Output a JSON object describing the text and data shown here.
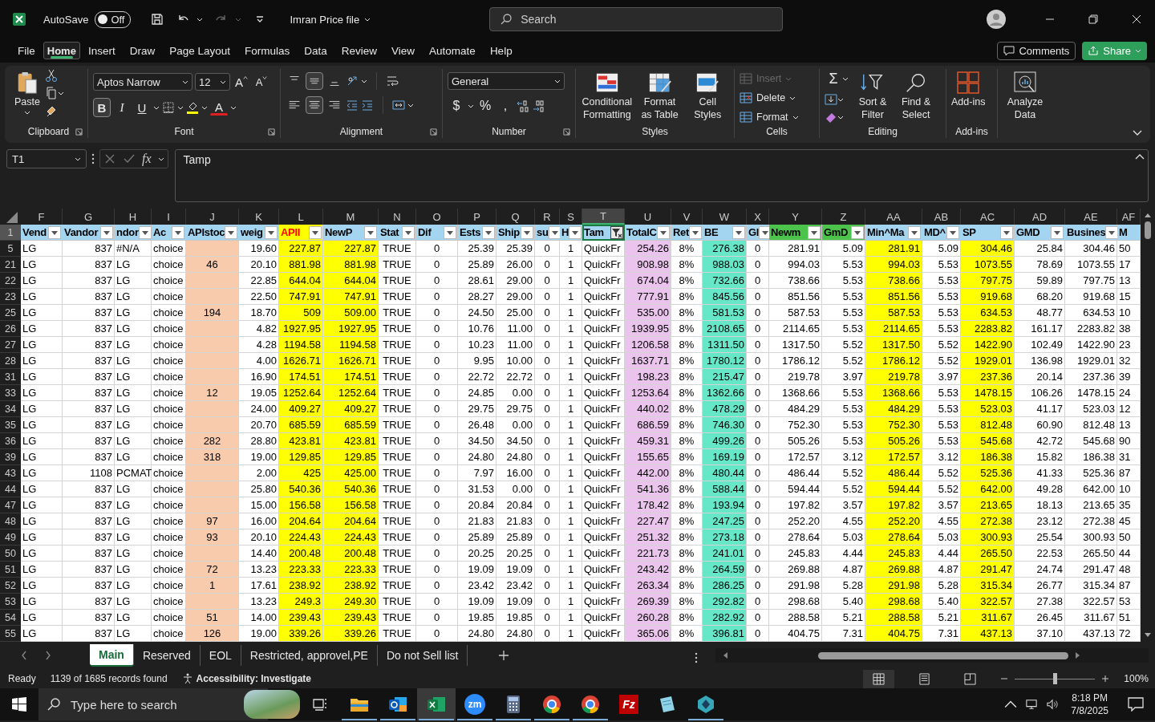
{
  "title_bar": {
    "autosave_label": "AutoSave",
    "autosave": {
      "on": false,
      "label": "Off"
    },
    "file_name": "Imran Price file",
    "search_placeholder": "Search"
  },
  "menu": {
    "tabs": [
      {
        "label": "File",
        "selected": false
      },
      {
        "label": "Home",
        "selected": true
      },
      {
        "label": "Insert",
        "selected": false
      },
      {
        "label": "Draw",
        "selected": false
      },
      {
        "label": "Page Layout",
        "selected": false
      },
      {
        "label": "Formulas",
        "selected": false
      },
      {
        "label": "Data",
        "selected": false
      },
      {
        "label": "Review",
        "selected": false
      },
      {
        "label": "View",
        "selected": false
      },
      {
        "label": "Automate",
        "selected": false
      },
      {
        "label": "Help",
        "selected": false
      }
    ],
    "comments": "Comments",
    "share": "Share"
  },
  "ribbon": {
    "clipboard": {
      "group": "Clipboard",
      "paste": "Paste"
    },
    "font": {
      "group": "Font",
      "family": "Aptos Narrow",
      "size": "12",
      "grow": "A",
      "shrink": "A",
      "font_color": "A",
      "format_buttons": [
        {
          "label": "B",
          "pressed": true
        },
        {
          "label": "I",
          "pressed": false
        },
        {
          "label": "U",
          "pressed": false
        }
      ]
    },
    "alignment": {
      "group": "Alignment",
      "vertical": [
        {
          "kind": "top",
          "pressed": false
        },
        {
          "kind": "middle",
          "pressed": true
        },
        {
          "kind": "bottom",
          "pressed": false
        }
      ],
      "horizontal": [
        {
          "kind": "left",
          "pressed": false
        },
        {
          "kind": "center",
          "pressed": true
        },
        {
          "kind": "right",
          "pressed": false
        }
      ]
    },
    "number": {
      "group": "Number",
      "format": "General",
      "symbols": [
        "$",
        "%",
        ","
      ]
    },
    "styles": {
      "group": "Styles",
      "buttons": [
        "Conditional Formatting",
        "Format as Table",
        "Cell Styles"
      ]
    },
    "cells": {
      "group": "Cells",
      "buttons": [
        {
          "label": "Insert",
          "disabled": true
        },
        {
          "label": "Delete",
          "disabled": false
        },
        {
          "label": "Format",
          "disabled": false
        }
      ]
    },
    "editing": {
      "group": "Editing",
      "sum": "Σ",
      "buttons": [
        "Sort & Filter",
        "Find & Select"
      ]
    },
    "addins": {
      "group": "Add-ins",
      "button": "Add-ins"
    },
    "analyze": {
      "button": "Analyze Data"
    }
  },
  "formula_bar": {
    "name_box": "T1",
    "function_label": "fx",
    "value": "Tamp"
  },
  "sheet": {
    "columns": [
      {
        "letter": "F",
        "header": {
          "label": "Vend",
          "color": "#a3d4f0",
          "kind": "plain"
        },
        "color": "#ffffff",
        "selected": false,
        "filter_applied": false
      },
      {
        "letter": "G",
        "header": {
          "label": "Vandor",
          "color": "#a3d4f0",
          "kind": "plain"
        },
        "color": "#ffffff",
        "selected": false,
        "filter_applied": false
      },
      {
        "letter": "H",
        "header": {
          "label": "ndor",
          "color": "#a3d4f0",
          "kind": "plain"
        },
        "color": "#ffffff",
        "selected": false,
        "filter_applied": false
      },
      {
        "letter": "I",
        "header": {
          "label": "Ac",
          "color": "#a3d4f0",
          "kind": "plain"
        },
        "color": "#ffffff",
        "selected": false,
        "filter_applied": false
      },
      {
        "letter": "J",
        "header": {
          "label": "APIstoc",
          "color": "#a3d4f0",
          "kind": "plain"
        },
        "color": "#f8cbad",
        "selected": false,
        "filter_applied": false
      },
      {
        "letter": "K",
        "header": {
          "label": "weig",
          "color": "#a3d4f0",
          "kind": "plain"
        },
        "color": "#ffffff",
        "selected": false,
        "filter_applied": false
      },
      {
        "letter": "L",
        "header": {
          "label": "APII",
          "color": "#ffff00",
          "kind": "alert"
        },
        "color": "#ffff00",
        "selected": false,
        "filter_applied": false
      },
      {
        "letter": "M",
        "header": {
          "label": "NewP",
          "color": "#a3d4f0",
          "kind": "plain"
        },
        "color": "#ffff00",
        "selected": false,
        "filter_applied": false
      },
      {
        "letter": "N",
        "header": {
          "label": "Stat",
          "color": "#a3d4f0",
          "kind": "plain"
        },
        "color": "#ffffff",
        "selected": false,
        "filter_applied": false
      },
      {
        "letter": "O",
        "header": {
          "label": "Dif",
          "color": "#a3d4f0",
          "kind": "plain"
        },
        "color": "#ffffff",
        "selected": false,
        "filter_applied": false
      },
      {
        "letter": "P",
        "header": {
          "label": "Ests",
          "color": "#a3d4f0",
          "kind": "plain"
        },
        "color": "#ffffff",
        "selected": false,
        "filter_applied": false
      },
      {
        "letter": "Q",
        "header": {
          "label": "Ship",
          "color": "#a3d4f0",
          "kind": "plain"
        },
        "color": "#ffffff",
        "selected": false,
        "filter_applied": false
      },
      {
        "letter": "R",
        "header": {
          "label": "su",
          "color": "#a3d4f0",
          "kind": "plain"
        },
        "color": "#ffffff",
        "selected": false,
        "filter_applied": false
      },
      {
        "letter": "S",
        "header": {
          "label": "H",
          "color": "#a3d4f0",
          "kind": "plain"
        },
        "color": "#ffffff",
        "selected": false,
        "filter_applied": false
      },
      {
        "letter": "T",
        "header": {
          "label": "Tam",
          "color": "#a3d4f0",
          "kind": "plain"
        },
        "color": "#ffffff",
        "selected": true,
        "filter_applied": true
      },
      {
        "letter": "U",
        "header": {
          "label": "TotalC",
          "color": "#a3d4f0",
          "kind": "plain"
        },
        "color": "#eac4ec",
        "selected": false,
        "filter_applied": false
      },
      {
        "letter": "V",
        "header": {
          "label": "Ret",
          "color": "#a3d4f0",
          "kind": "plain"
        },
        "color": "#ffffff",
        "selected": false,
        "filter_applied": false
      },
      {
        "letter": "W",
        "header": {
          "label": "BE",
          "color": "#a3d4f0",
          "kind": "plain"
        },
        "color": "#66e8c8",
        "selected": false,
        "filter_applied": false
      },
      {
        "letter": "X",
        "header": {
          "label": "Gl",
          "color": "#a3d4f0",
          "kind": "plain"
        },
        "color": "#ffffff",
        "selected": false,
        "filter_applied": false
      },
      {
        "letter": "Y",
        "header": {
          "label": "Newm",
          "color": "#4cc44c",
          "kind": "plain"
        },
        "color": "#ffffff",
        "selected": false,
        "filter_applied": false
      },
      {
        "letter": "Z",
        "header": {
          "label": "GmD",
          "color": "#4cc44c",
          "kind": "plain"
        },
        "color": "#ffffff",
        "selected": false,
        "filter_applied": false
      },
      {
        "letter": "AA",
        "header": {
          "label": "Min^Ma",
          "color": "#a3d4f0",
          "kind": "plain"
        },
        "color": "#ffff00",
        "selected": false,
        "filter_applied": false
      },
      {
        "letter": "AB",
        "header": {
          "label": "MD^",
          "color": "#a3d4f0",
          "kind": "plain"
        },
        "color": "#ffffff",
        "selected": false,
        "filter_applied": false
      },
      {
        "letter": "AC",
        "header": {
          "label": "SP",
          "color": "#a3d4f0",
          "kind": "plain"
        },
        "color": "#ffff00",
        "selected": false,
        "filter_applied": false
      },
      {
        "letter": "AD",
        "header": {
          "label": "GMD",
          "color": "#a3d4f0",
          "kind": "plain"
        },
        "color": "#ffffff",
        "selected": false,
        "filter_applied": false
      },
      {
        "letter": "AE",
        "header": {
          "label": "Busines",
          "color": "#a3d4f0",
          "kind": "plain"
        },
        "color": "#ffffff",
        "selected": false,
        "filter_applied": false
      },
      {
        "letter": "AF",
        "header": {
          "label": "M",
          "color": "#a3d4f0",
          "kind": "plain"
        },
        "color": "#ffffff",
        "selected": false
      }
    ],
    "header_row": "1",
    "rows": [
      {
        "number": "5",
        "cells": [
          "LG",
          "837",
          "#N/A",
          "choice",
          null,
          "19.60",
          "227.87",
          "227.87",
          "TRUE",
          "0",
          "25.39",
          "25.39",
          "0",
          "1",
          "QuickFr",
          "254.26",
          "8%",
          "276.38",
          "0",
          "281.91",
          "5.09",
          "281.91",
          "5.09",
          "304.46",
          "25.84",
          "304.46",
          "50"
        ]
      },
      {
        "number": "21",
        "cells": [
          "LG",
          "837",
          "LG",
          "choice",
          "46",
          "20.10",
          "881.98",
          "881.98",
          "TRUE",
          "0",
          "25.89",
          "26.00",
          "0",
          "1",
          "QuickFr",
          "908.98",
          "8%",
          "988.03",
          "0",
          "994.03",
          "5.53",
          "994.03",
          "5.53",
          "1073.55",
          "78.69",
          "1073.55",
          "17"
        ]
      },
      {
        "number": "22",
        "cells": [
          "LG",
          "837",
          "LG",
          "choice",
          null,
          "22.85",
          "644.04",
          "644.04",
          "TRUE",
          "0",
          "28.61",
          "29.00",
          "0",
          "1",
          "QuickFr",
          "674.04",
          "8%",
          "732.66",
          "0",
          "738.66",
          "5.53",
          "738.66",
          "5.53",
          "797.75",
          "59.89",
          "797.75",
          "13"
        ]
      },
      {
        "number": "23",
        "cells": [
          "LG",
          "837",
          "LG",
          "choice",
          null,
          "22.50",
          "747.91",
          "747.91",
          "TRUE",
          "0",
          "28.27",
          "29.00",
          "0",
          "1",
          "QuickFr",
          "777.91",
          "8%",
          "845.56",
          "0",
          "851.56",
          "5.53",
          "851.56",
          "5.53",
          "919.68",
          "68.20",
          "919.68",
          "15"
        ]
      },
      {
        "number": "25",
        "cells": [
          "LG",
          "837",
          "LG",
          "choice",
          "194",
          "18.70",
          "509",
          "509.00",
          "TRUE",
          "0",
          "24.50",
          "25.00",
          "0",
          "1",
          "QuickFr",
          "535.00",
          "8%",
          "581.53",
          "0",
          "587.53",
          "5.53",
          "587.53",
          "5.53",
          "634.53",
          "48.77",
          "634.53",
          "10"
        ]
      },
      {
        "number": "26",
        "cells": [
          "LG",
          "837",
          "LG",
          "choice",
          null,
          "4.82",
          "1927.95",
          "1927.95",
          "TRUE",
          "0",
          "10.76",
          "11.00",
          "0",
          "1",
          "QuickFr",
          "1939.95",
          "8%",
          "2108.65",
          "0",
          "2114.65",
          "5.53",
          "2114.65",
          "5.53",
          "2283.82",
          "161.17",
          "2283.82",
          "38"
        ]
      },
      {
        "number": "27",
        "cells": [
          "LG",
          "837",
          "LG",
          "choice",
          null,
          "4.28",
          "1194.58",
          "1194.58",
          "TRUE",
          "0",
          "10.23",
          "11.00",
          "0",
          "1",
          "QuickFr",
          "1206.58",
          "8%",
          "1311.50",
          "0",
          "1317.50",
          "5.52",
          "1317.50",
          "5.52",
          "1422.90",
          "102.49",
          "1422.90",
          "23"
        ]
      },
      {
        "number": "28",
        "cells": [
          "LG",
          "837",
          "LG",
          "choice",
          null,
          "4.00",
          "1626.71",
          "1626.71",
          "TRUE",
          "0",
          "9.95",
          "10.00",
          "0",
          "1",
          "QuickFr",
          "1637.71",
          "8%",
          "1780.12",
          "0",
          "1786.12",
          "5.52",
          "1786.12",
          "5.52",
          "1929.01",
          "136.98",
          "1929.01",
          "32"
        ]
      },
      {
        "number": "31",
        "cells": [
          "LG",
          "837",
          "LG",
          "choice",
          null,
          "16.90",
          "174.51",
          "174.51",
          "TRUE",
          "0",
          "22.72",
          "22.72",
          "0",
          "1",
          "QuickFr",
          "198.23",
          "8%",
          "215.47",
          "0",
          "219.78",
          "3.97",
          "219.78",
          "3.97",
          "237.36",
          "20.14",
          "237.36",
          "39"
        ]
      },
      {
        "number": "33",
        "cells": [
          "LG",
          "837",
          "LG",
          "choice",
          "12",
          "19.05",
          "1252.64",
          "1252.64",
          "TRUE",
          "0",
          "24.85",
          "0.00",
          "0",
          "1",
          "QuickFr",
          "1253.64",
          "8%",
          "1362.66",
          "0",
          "1368.66",
          "5.53",
          "1368.66",
          "5.53",
          "1478.15",
          "106.26",
          "1478.15",
          "24"
        ]
      },
      {
        "number": "34",
        "cells": [
          "LG",
          "837",
          "LG",
          "choice",
          null,
          "24.00",
          "409.27",
          "409.27",
          "TRUE",
          "0",
          "29.75",
          "29.75",
          "0",
          "1",
          "QuickFr",
          "440.02",
          "8%",
          "478.29",
          "0",
          "484.29",
          "5.53",
          "484.29",
          "5.53",
          "523.03",
          "41.17",
          "523.03",
          "12"
        ]
      },
      {
        "number": "35",
        "cells": [
          "LG",
          "837",
          "LG",
          "choice",
          null,
          "20.70",
          "685.59",
          "685.59",
          "TRUE",
          "0",
          "26.48",
          "0.00",
          "0",
          "1",
          "QuickFr",
          "686.59",
          "8%",
          "746.30",
          "0",
          "752.30",
          "5.53",
          "752.30",
          "5.53",
          "812.48",
          "60.90",
          "812.48",
          "13"
        ]
      },
      {
        "number": "36",
        "cells": [
          "LG",
          "837",
          "LG",
          "choice",
          "282",
          "28.80",
          "423.81",
          "423.81",
          "TRUE",
          "0",
          "34.50",
          "34.50",
          "0",
          "1",
          "QuickFr",
          "459.31",
          "8%",
          "499.26",
          "0",
          "505.26",
          "5.53",
          "505.26",
          "5.53",
          "545.68",
          "42.72",
          "545.68",
          "90"
        ]
      },
      {
        "number": "39",
        "cells": [
          "LG",
          "837",
          "LG",
          "choice",
          "318",
          "19.00",
          "129.85",
          "129.85",
          "TRUE",
          "0",
          "24.80",
          "24.80",
          "0",
          "1",
          "QuickFr",
          "155.65",
          "8%",
          "169.19",
          "0",
          "172.57",
          "3.12",
          "172.57",
          "3.12",
          "186.38",
          "15.82",
          "186.38",
          "31"
        ]
      },
      {
        "number": "43",
        "cells": [
          "LG",
          "1108",
          "PCMAT",
          "choice",
          null,
          "2.00",
          "425",
          "425.00",
          "TRUE",
          "0",
          "7.97",
          "16.00",
          "0",
          "1",
          "QuickFr",
          "442.00",
          "8%",
          "480.44",
          "0",
          "486.44",
          "5.52",
          "486.44",
          "5.52",
          "525.36",
          "41.33",
          "525.36",
          "87"
        ]
      },
      {
        "number": "44",
        "cells": [
          "LG",
          "837",
          "LG",
          "choice",
          null,
          "25.80",
          "540.36",
          "540.36",
          "TRUE",
          "0",
          "31.53",
          "0.00",
          "0",
          "1",
          "QuickFr",
          "541.36",
          "8%",
          "588.44",
          "0",
          "594.44",
          "5.52",
          "594.44",
          "5.52",
          "642.00",
          "49.28",
          "642.00",
          "10"
        ]
      },
      {
        "number": "47",
        "cells": [
          "LG",
          "837",
          "LG",
          "choice",
          null,
          "15.00",
          "156.58",
          "156.58",
          "TRUE",
          "0",
          "20.84",
          "20.84",
          "0",
          "1",
          "QuickFr",
          "178.42",
          "8%",
          "193.94",
          "0",
          "197.82",
          "3.57",
          "197.82",
          "3.57",
          "213.65",
          "18.13",
          "213.65",
          "35"
        ]
      },
      {
        "number": "48",
        "cells": [
          "LG",
          "837",
          "LG",
          "choice",
          "97",
          "16.00",
          "204.64",
          "204.64",
          "TRUE",
          "0",
          "21.83",
          "21.83",
          "0",
          "1",
          "QuickFr",
          "227.47",
          "8%",
          "247.25",
          "0",
          "252.20",
          "4.55",
          "252.20",
          "4.55",
          "272.38",
          "23.12",
          "272.38",
          "45"
        ]
      },
      {
        "number": "49",
        "cells": [
          "LG",
          "837",
          "LG",
          "choice",
          "93",
          "20.10",
          "224.43",
          "224.43",
          "TRUE",
          "0",
          "25.89",
          "25.89",
          "0",
          "1",
          "QuickFr",
          "251.32",
          "8%",
          "273.18",
          "0",
          "278.64",
          "5.03",
          "278.64",
          "5.03",
          "300.93",
          "25.54",
          "300.93",
          "50"
        ]
      },
      {
        "number": "50",
        "cells": [
          "LG",
          "837",
          "LG",
          "choice",
          null,
          "14.40",
          "200.48",
          "200.48",
          "TRUE",
          "0",
          "20.25",
          "20.25",
          "0",
          "1",
          "QuickFr",
          "221.73",
          "8%",
          "241.01",
          "0",
          "245.83",
          "4.44",
          "245.83",
          "4.44",
          "265.50",
          "22.53",
          "265.50",
          "44"
        ]
      },
      {
        "number": "51",
        "cells": [
          "LG",
          "837",
          "LG",
          "choice",
          "72",
          "13.23",
          "223.33",
          "223.33",
          "TRUE",
          "0",
          "19.09",
          "19.09",
          "0",
          "1",
          "QuickFr",
          "243.42",
          "8%",
          "264.59",
          "0",
          "269.88",
          "4.87",
          "269.88",
          "4.87",
          "291.47",
          "24.74",
          "291.47",
          "48"
        ]
      },
      {
        "number": "52",
        "cells": [
          "LG",
          "837",
          "LG",
          "choice",
          "1",
          "17.61",
          "238.92",
          "238.92",
          "TRUE",
          "0",
          "23.42",
          "23.42",
          "0",
          "1",
          "QuickFr",
          "263.34",
          "8%",
          "286.25",
          "0",
          "291.98",
          "5.28",
          "291.98",
          "5.28",
          "315.34",
          "26.77",
          "315.34",
          "87"
        ]
      },
      {
        "number": "53",
        "cells": [
          "LG",
          "837",
          "LG",
          "choice",
          null,
          "13.23",
          "249.3",
          "249.30",
          "TRUE",
          "0",
          "19.09",
          "19.09",
          "0",
          "1",
          "QuickFr",
          "269.39",
          "8%",
          "292.82",
          "0",
          "298.68",
          "5.40",
          "298.68",
          "5.40",
          "322.57",
          "27.38",
          "322.57",
          "53"
        ]
      },
      {
        "number": "54",
        "cells": [
          "LG",
          "837",
          "LG",
          "choice",
          "51",
          "14.00",
          "239.43",
          "239.43",
          "TRUE",
          "0",
          "19.85",
          "19.85",
          "0",
          "1",
          "QuickFr",
          "260.28",
          "8%",
          "282.92",
          "0",
          "288.58",
          "5.21",
          "288.58",
          "5.21",
          "311.67",
          "26.45",
          "311.67",
          "51"
        ]
      },
      {
        "number": "55",
        "cells": [
          "LG",
          "837",
          "LG",
          "choice",
          "126",
          "19.00",
          "339.26",
          "339.26",
          "TRUE",
          "0",
          "24.80",
          "24.80",
          "0",
          "1",
          "QuickFr",
          "365.06",
          "8%",
          "396.81",
          "0",
          "404.75",
          "7.31",
          "404.75",
          "7.31",
          "437.13",
          "37.10",
          "437.13",
          "72"
        ]
      }
    ]
  },
  "sheet_tabs": [
    {
      "label": "Main",
      "selected": true
    },
    {
      "label": "Reserved",
      "selected": false
    },
    {
      "label": "EOL",
      "selected": false
    },
    {
      "label": "Restricted, approvel,PE",
      "selected": false
    },
    {
      "label": "Do not Sell list",
      "selected": false
    }
  ],
  "status_bar": {
    "ready": "Ready",
    "records": "1139 of 1685 records found",
    "accessibility": "Accessibility: Investigate",
    "zoom": {
      "level": 0.5,
      "label": "100%"
    }
  },
  "taskbar": {
    "search_placeholder": "Type here to search",
    "apps": [
      {
        "kind": "folder",
        "active": false,
        "running": true
      },
      {
        "kind": "outlook",
        "active": false,
        "running": true
      },
      {
        "kind": "excel",
        "active": true,
        "running": true
      },
      {
        "kind": "zoom",
        "label": "zm",
        "active": false,
        "running": true
      },
      {
        "kind": "calculator",
        "active": false,
        "running": true
      },
      {
        "kind": "chrome",
        "active": false,
        "running": true
      },
      {
        "kind": "chrome",
        "active": false,
        "running": true
      },
      {
        "kind": "filezilla",
        "label": "Fz",
        "active": false,
        "running": false
      },
      {
        "kind": "notepad",
        "active": false,
        "running": false
      },
      {
        "kind": "cube",
        "active": false,
        "running": true
      }
    ],
    "time": "8:18 PM",
    "date": "7/8/2025"
  }
}
